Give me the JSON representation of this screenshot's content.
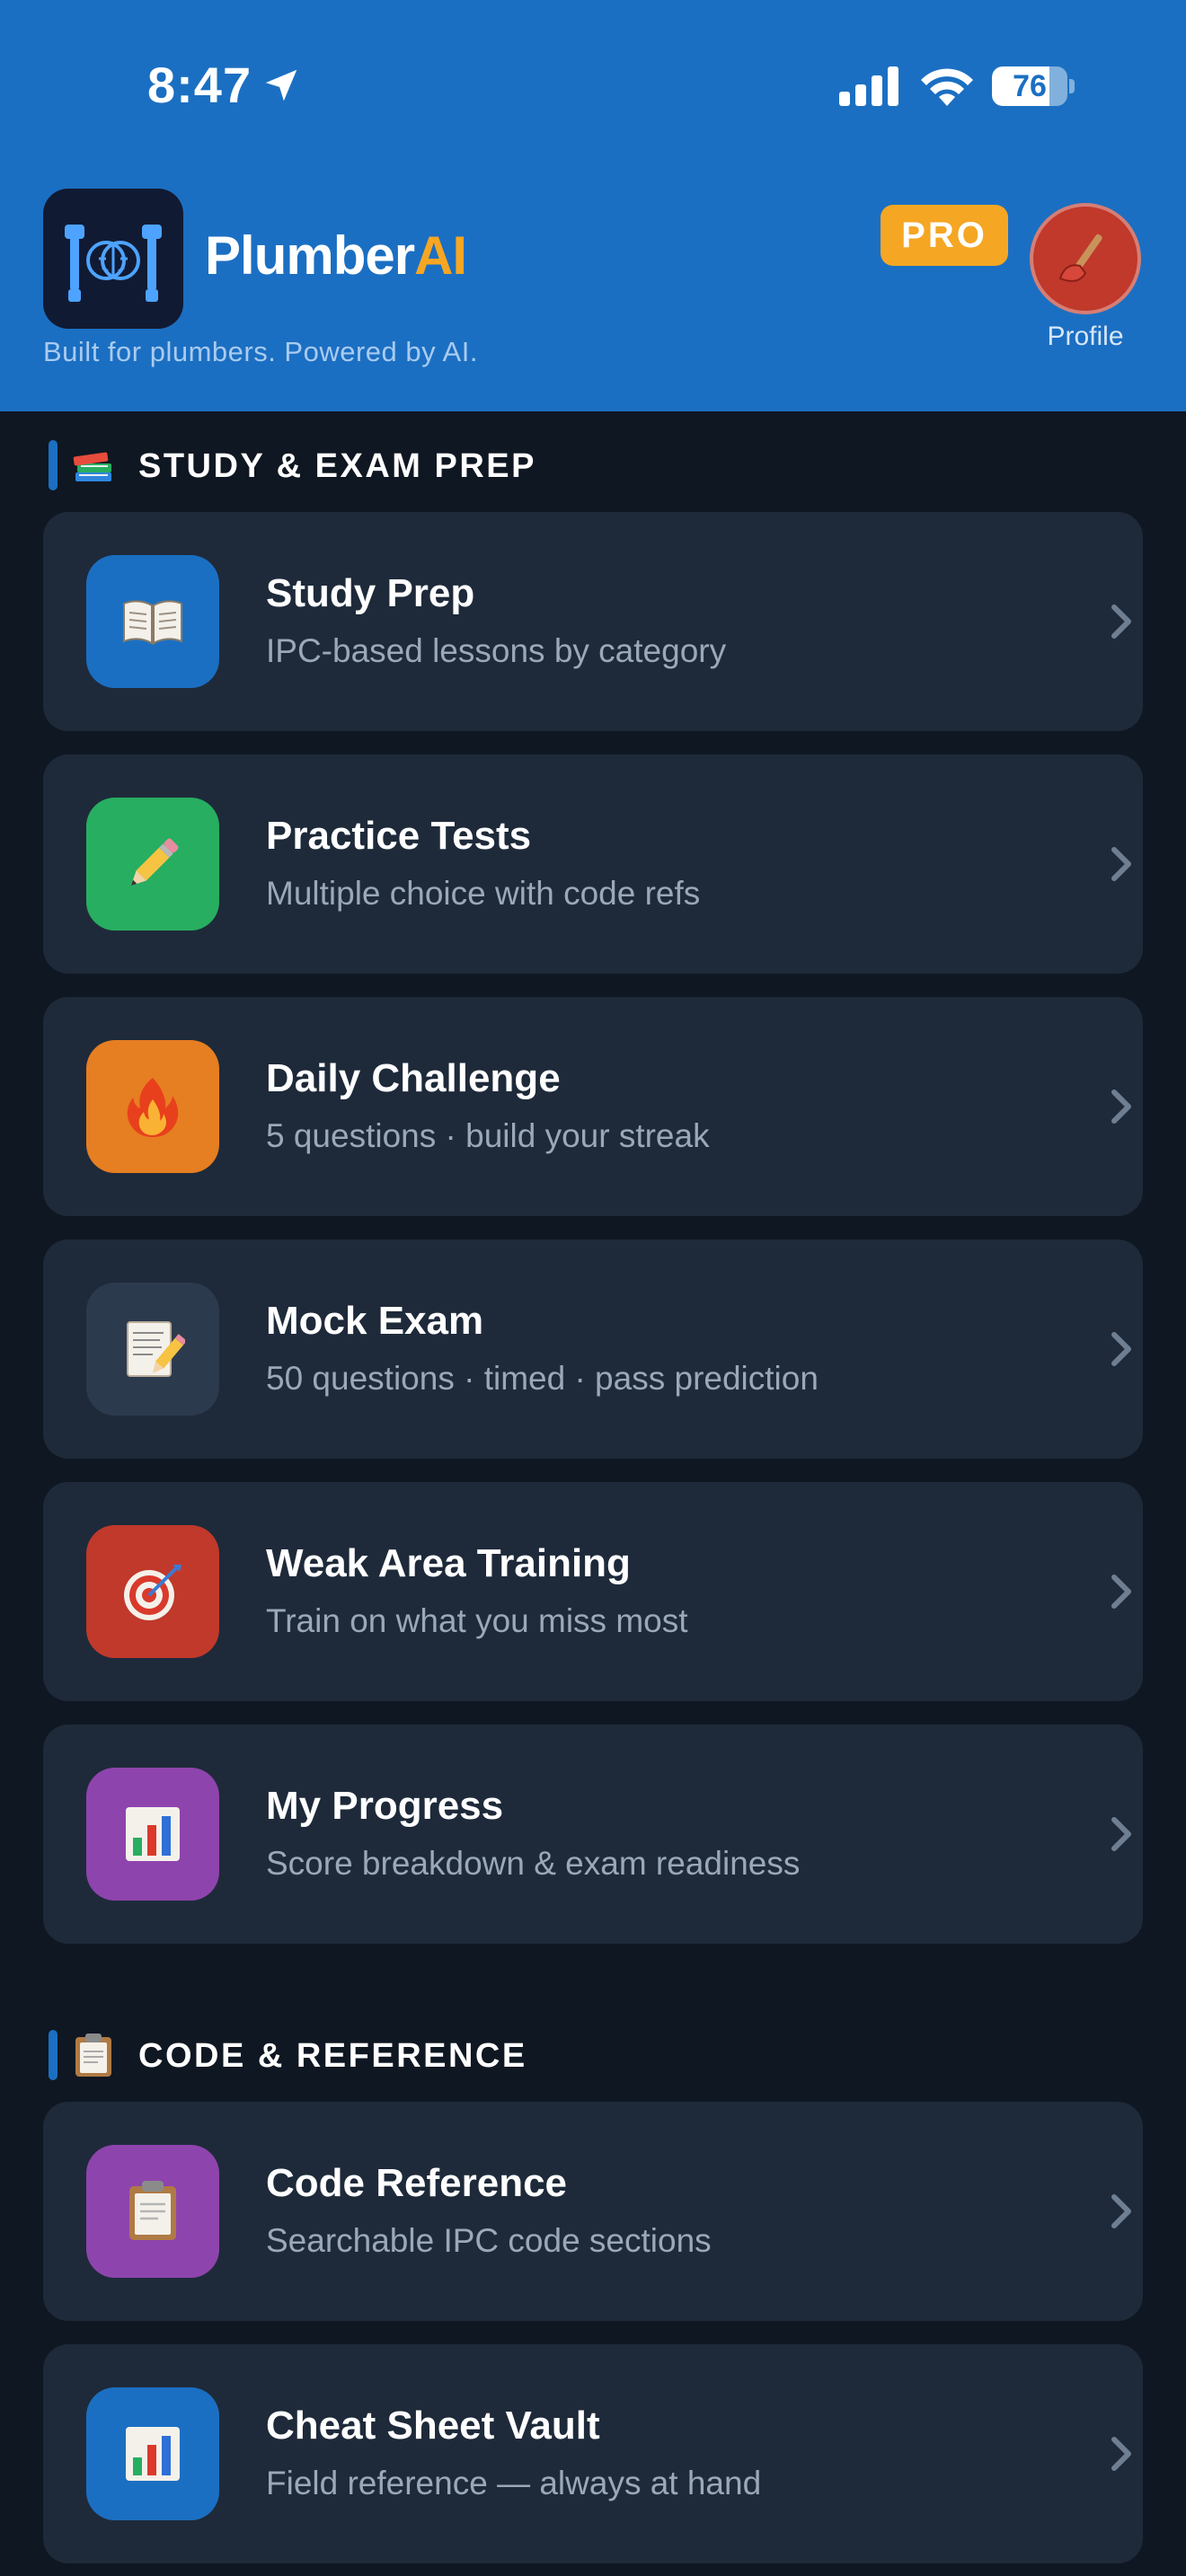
{
  "status_bar": {
    "time": "8:47",
    "battery": "76",
    "battery_level": 0.76
  },
  "header": {
    "app_name_part1": "Plumber",
    "app_name_part2": "AI",
    "tagline": "Built for plumbers. Powered by AI.",
    "pro_badge": "PRO",
    "profile_label": "Profile",
    "colors": {
      "header_bg": "#1b6fc2",
      "accent": "#f6a623",
      "avatar_bg": "#c0392b"
    }
  },
  "sections": [
    {
      "title": "STUDY & EXAM PREP",
      "emoji": "books-icon",
      "items": [
        {
          "title": "Study Prep",
          "subtitle": "IPC-based lessons by category",
          "icon": "open-book-icon",
          "color": "#1b6fc2"
        },
        {
          "title": "Practice Tests",
          "subtitle": "Multiple choice with code refs",
          "icon": "pencil-icon",
          "color": "#27ae60"
        },
        {
          "title": "Daily Challenge",
          "subtitle": "5 questions · build your streak",
          "icon": "fire-icon",
          "color": "#e67e22"
        },
        {
          "title": "Mock Exam",
          "subtitle": "50 questions · timed · pass prediction",
          "icon": "memo-icon",
          "color": "#2c3a4e"
        },
        {
          "title": "Weak Area Training",
          "subtitle": "Train on what you miss most",
          "icon": "target-icon",
          "color": "#c0392b"
        },
        {
          "title": "My Progress",
          "subtitle": "Score breakdown & exam readiness",
          "icon": "bar-chart-icon",
          "color": "#8e44ad"
        }
      ]
    },
    {
      "title": "CODE & REFERENCE",
      "emoji": "clipboard-icon",
      "items": [
        {
          "title": "Code Reference",
          "subtitle": "Searchable IPC code sections",
          "icon": "clipboard-icon",
          "color": "#8e44ad"
        },
        {
          "title": "Cheat Sheet Vault",
          "subtitle": "Field reference — always at hand",
          "icon": "bar-chart-icon",
          "color": "#1b6fc2"
        }
      ]
    }
  ]
}
